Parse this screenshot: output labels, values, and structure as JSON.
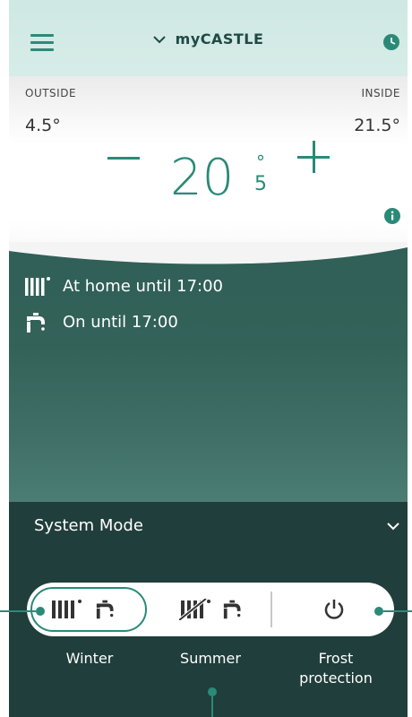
{
  "header": {
    "title": "myCASTLE",
    "menu_icon": "hamburger-menu-icon",
    "title_icon": "chevron-down-icon",
    "schedule_icon": "clock-icon"
  },
  "temperature": {
    "outside_label": "OUTSIDE",
    "outside_value": "4.5°",
    "inside_label": "INSIDE",
    "inside_value": "21.5°",
    "setpoint_integer": "20",
    "setpoint_degree": "°",
    "setpoint_decimal": "5",
    "decrease_icon": "minus-icon",
    "increase_icon": "plus-icon",
    "info_icon": "info-icon"
  },
  "status": {
    "heating_text": "At home until 17:00",
    "heating_icon": "radiator-icon",
    "hot_water_text": "On until 17:00",
    "hot_water_icon": "tap-icon"
  },
  "system_mode": {
    "title": "System Mode",
    "expand_icon": "chevron-down-icon",
    "selected": "Winter",
    "modes": [
      {
        "label": "Winter",
        "icons": [
          "radiator-icon",
          "tap-icon"
        ]
      },
      {
        "label": "Summer",
        "icons": [
          "radiator-off-icon",
          "tap-icon"
        ]
      },
      {
        "label": "Frost protection",
        "label_line1": "Frost",
        "label_line2": "protection",
        "icons": [
          "power-icon"
        ]
      }
    ]
  },
  "colors": {
    "accent": "#2a8a78",
    "header_bg": "#cfe8e3",
    "panel_bg": "#336259",
    "bottom_bg": "#203e3b"
  }
}
